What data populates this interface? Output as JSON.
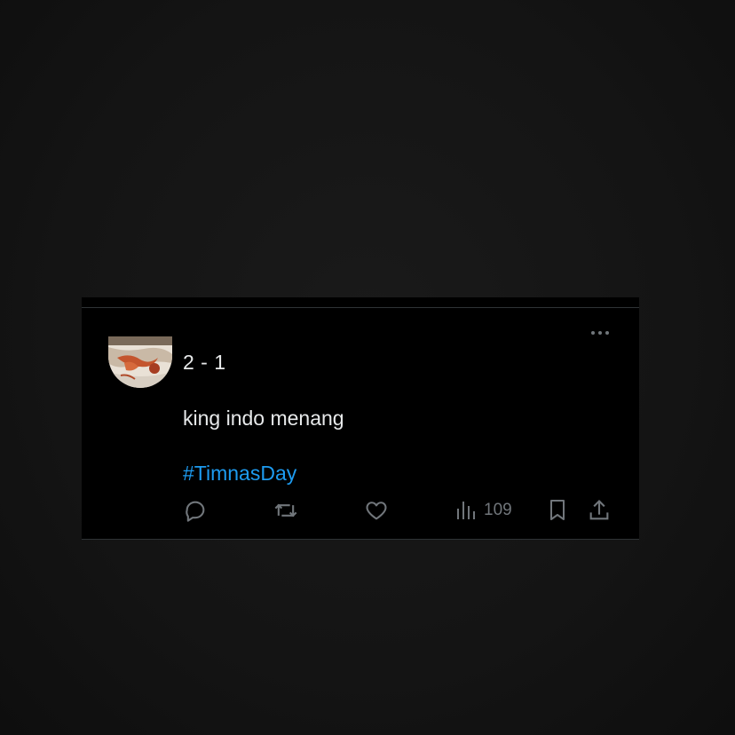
{
  "tweet": {
    "text_line1": "2 - 1",
    "text_line2": "king indo menang",
    "hashtag": "#TimnasDay"
  },
  "actions": {
    "reply_icon": "reply-icon",
    "retweet_icon": "retweet-icon",
    "like_icon": "heart-icon",
    "views_icon": "bar-chart-icon",
    "views_count": "109",
    "bookmark_icon": "bookmark-icon",
    "share_icon": "share-icon"
  },
  "colors": {
    "background": "#161616",
    "card": "#000000",
    "text": "#e7e9ea",
    "muted": "#71767b",
    "link": "#1d9bf0",
    "divider": "#2f3336"
  }
}
